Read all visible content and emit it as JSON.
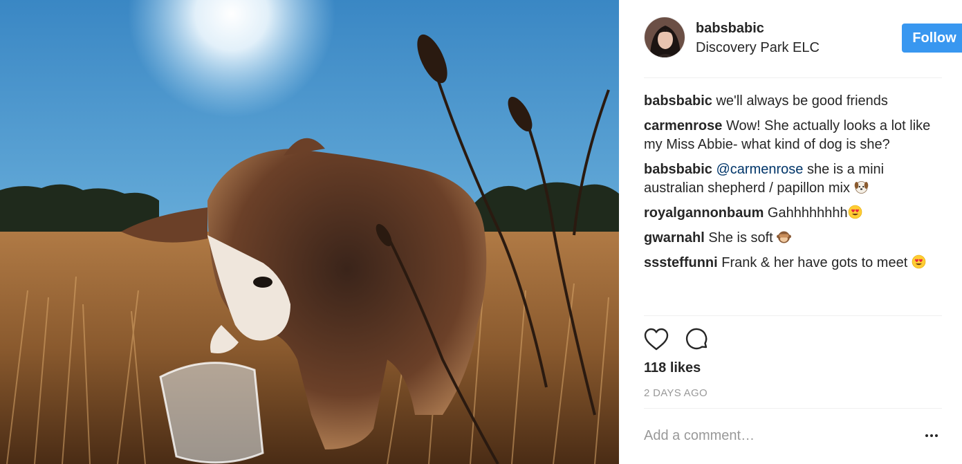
{
  "post": {
    "photo_subject": "dog in grass field",
    "owner_username": "babsbabic",
    "location": "Discovery Park ELC",
    "follow_label": "Follow",
    "likes": "118 likes",
    "timestamp": "2 DAYS AGO",
    "comment_placeholder": "Add a comment…"
  },
  "comments": [
    {
      "user": "babsbabic",
      "text": "we'll always be good friends"
    },
    {
      "user": "carmenrose",
      "text": "Wow! She actually looks a lot like my Miss Abbie- what kind of dog is she?"
    },
    {
      "user": "babsbabic",
      "mention": "@carmenrose",
      "text": "she is a mini australian shepherd / papillon mix",
      "emoji": "dog-face-emoji"
    },
    {
      "user": "royalgannonbaum",
      "text": "Gahhhhhhhh",
      "emoji": "heart-eyes-emoji"
    },
    {
      "user": "gwarnahl",
      "text": "She is soft",
      "emoji": "see-no-evil-monkey-emoji"
    },
    {
      "user": "sssteffunni",
      "text": "Frank & her have gots to meet",
      "emoji": "heart-eyes-emoji"
    }
  ],
  "icons": {
    "like": "heart-outline-icon",
    "comment": "speech-bubble-icon",
    "more": "more-options-icon"
  },
  "colors": {
    "accent": "#3897f0",
    "text": "#262626",
    "muted": "#999999",
    "mention": "#003569",
    "divider": "#efefef"
  }
}
